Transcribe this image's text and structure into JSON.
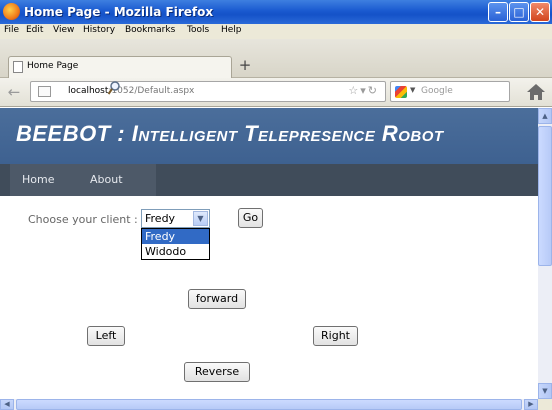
{
  "window": {
    "title": "Home Page - Mozilla Firefox"
  },
  "menubar": {
    "items": [
      "File",
      "Edit",
      "View",
      "History",
      "Bookmarks",
      "Tools",
      "Help"
    ]
  },
  "tabs": [
    {
      "label": "Home Page"
    }
  ],
  "new_tab_label": "+",
  "address": {
    "host": "localhost",
    "rest": ":1052/Default.aspx"
  },
  "search": {
    "placeholder": "Google"
  },
  "page": {
    "banner_title": "BEEBOT : Intelligent Telepresence Robot",
    "nav": [
      "Home",
      "About"
    ],
    "client_label": "Choose your client :",
    "client_selected": "Fredy",
    "client_options": [
      "Fredy",
      "Widodo"
    ],
    "go_label": "Go",
    "forward_label": "forward",
    "left_label": "Left",
    "right_label": "Right",
    "reverse_label": "Reverse"
  },
  "colors": {
    "banner": "#4a6d9b",
    "nav": "#404c5a",
    "selection": "#316ac5",
    "titlebar": "#1a5ad0"
  }
}
